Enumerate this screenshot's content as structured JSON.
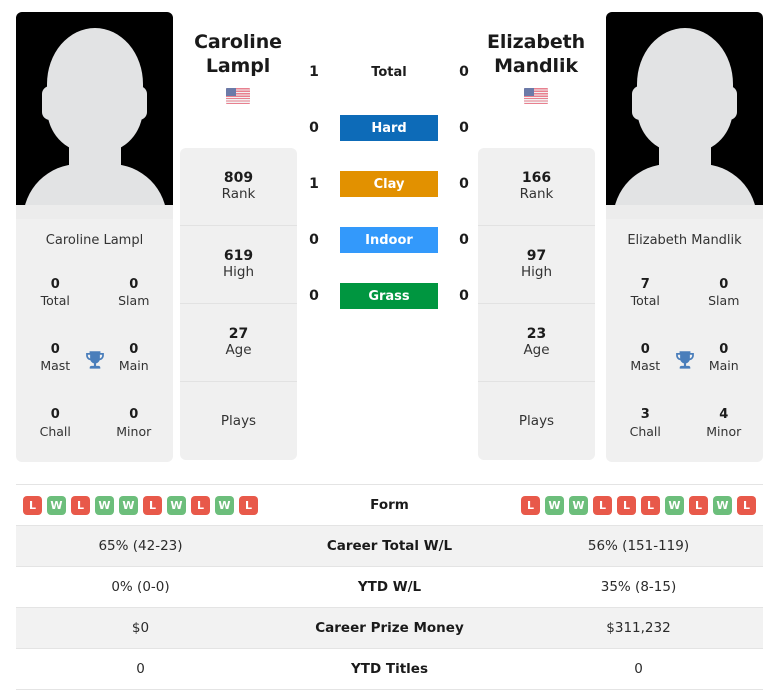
{
  "players": {
    "left": {
      "first_name": "Caroline",
      "last_name": "Lampl",
      "full_name": "Caroline Lampl",
      "flag": "us-flag-icon",
      "avatar": "player-photo-placeholder",
      "stats": [
        {
          "value": "809",
          "label": "Rank"
        },
        {
          "value": "619",
          "label": "High"
        },
        {
          "value": "27",
          "label": "Age"
        },
        {
          "value": "",
          "label": "Plays"
        }
      ],
      "titles": [
        {
          "value": "0",
          "label": "Total"
        },
        {
          "value": "0",
          "label": "Slam"
        },
        {
          "value": "0",
          "label": "Mast"
        },
        {
          "value": "0",
          "label": "Main"
        },
        {
          "value": "0",
          "label": "Chall"
        },
        {
          "value": "0",
          "label": "Minor"
        }
      ],
      "form": [
        "L",
        "W",
        "L",
        "W",
        "W",
        "L",
        "W",
        "L",
        "W",
        "L"
      ],
      "career_total_wl": "65% (42-23)",
      "ytd_wl": "0% (0-0)",
      "career_prize_money": "$0",
      "ytd_titles": "0"
    },
    "right": {
      "first_name": "Elizabeth",
      "last_name": "Mandlik",
      "full_name": "Elizabeth Mandlik",
      "flag": "us-flag-icon",
      "avatar": "player-photo-placeholder",
      "stats": [
        {
          "value": "166",
          "label": "Rank"
        },
        {
          "value": "97",
          "label": "High"
        },
        {
          "value": "23",
          "label": "Age"
        },
        {
          "value": "",
          "label": "Plays"
        }
      ],
      "titles": [
        {
          "value": "7",
          "label": "Total"
        },
        {
          "value": "0",
          "label": "Slam"
        },
        {
          "value": "0",
          "label": "Mast"
        },
        {
          "value": "0",
          "label": "Main"
        },
        {
          "value": "3",
          "label": "Chall"
        },
        {
          "value": "4",
          "label": "Minor"
        }
      ],
      "form": [
        "L",
        "W",
        "W",
        "L",
        "L",
        "L",
        "W",
        "L",
        "W",
        "L"
      ],
      "career_total_wl": "56% (151-119)",
      "ytd_wl": "35% (8-15)",
      "career_prize_money": "$311,232",
      "ytd_titles": "0"
    }
  },
  "head_to_head": {
    "rows": [
      {
        "label": "Total",
        "left": "1",
        "right": "0",
        "color": "",
        "plain": true
      },
      {
        "label": "Hard",
        "left": "0",
        "right": "0",
        "color": "#0d6bb8",
        "plain": false
      },
      {
        "label": "Clay",
        "left": "1",
        "right": "0",
        "color": "#e29100",
        "plain": false
      },
      {
        "label": "Indoor",
        "left": "0",
        "right": "0",
        "color": "#3399fb",
        "plain": false
      },
      {
        "label": "Grass",
        "left": "0",
        "right": "0",
        "color": "#009640",
        "plain": false
      }
    ]
  },
  "comparison_table": {
    "rows": [
      {
        "label": "Form",
        "type": "form"
      },
      {
        "label": "Career Total W/L",
        "type": "text",
        "key": "career_total_wl"
      },
      {
        "label": "YTD W/L",
        "type": "text",
        "key": "ytd_wl"
      },
      {
        "label": "Career Prize Money",
        "type": "text",
        "key": "career_prize_money"
      },
      {
        "label": "YTD Titles",
        "type": "text",
        "key": "ytd_titles"
      }
    ]
  },
  "colors": {
    "hard": "#0d6bb8",
    "clay": "#e29100",
    "indoor": "#3399fb",
    "grass": "#009640",
    "win_badge": "#6cbe7b",
    "loss_badge": "#e8594a",
    "trophy": "#4a7ebb",
    "card_bg": "#f0f0f0",
    "row_alt_bg": "#f2f2f2"
  }
}
